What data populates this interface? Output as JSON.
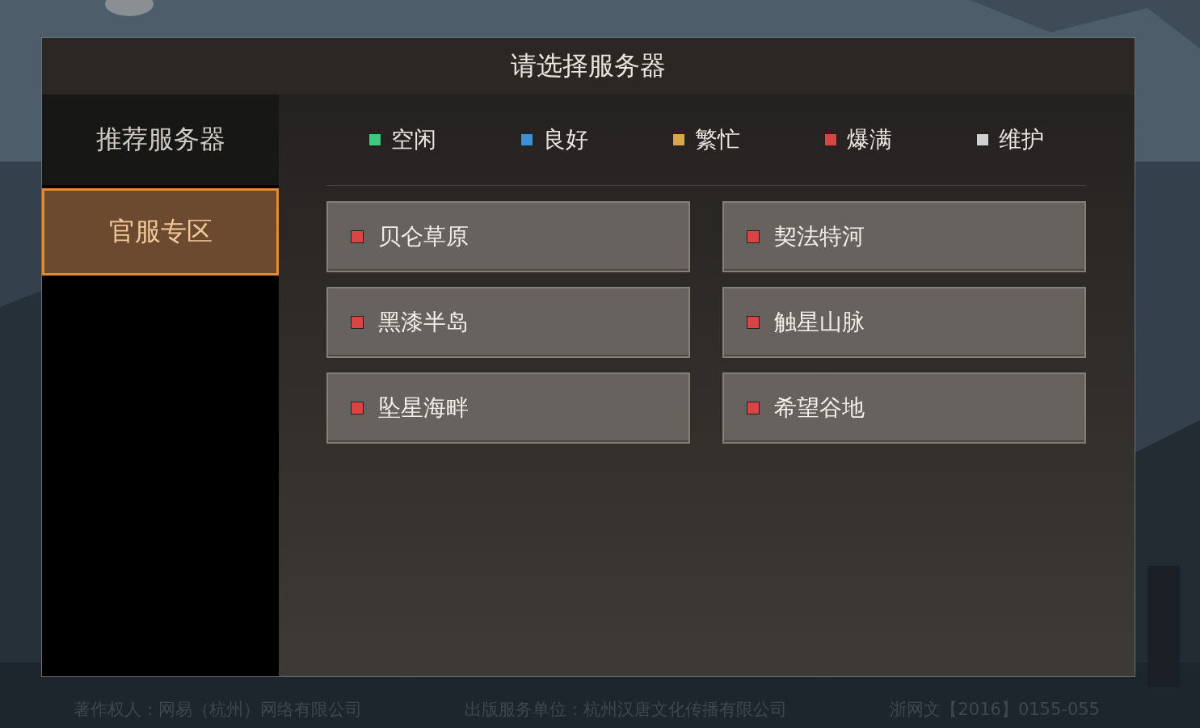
{
  "dialog": {
    "title": "请选择服务器"
  },
  "sidebar": {
    "items": [
      {
        "label": "推荐服务器",
        "selected": false
      },
      {
        "label": "官服专区",
        "selected": true
      }
    ]
  },
  "legend": [
    {
      "label": "空闲",
      "color": "#3ec97f"
    },
    {
      "label": "良好",
      "color": "#3d8fd6"
    },
    {
      "label": "繁忙",
      "color": "#d9a64a"
    },
    {
      "label": "爆满",
      "color": "#d94545"
    },
    {
      "label": "维护",
      "color": "#d0d0d0"
    }
  ],
  "servers": [
    {
      "name": "贝仑草原",
      "color": "#d94545"
    },
    {
      "name": "契法特河",
      "color": "#d94545"
    },
    {
      "name": "黑漆半岛",
      "color": "#d94545"
    },
    {
      "name": "触星山脉",
      "color": "#d94545"
    },
    {
      "name": "坠星海畔",
      "color": "#d94545"
    },
    {
      "name": "希望谷地",
      "color": "#d94545"
    }
  ],
  "footer": [
    "著作权人：网易（杭州）网络有限公司",
    "出版服务单位：杭州汉唐文化传播有限公司",
    "浙网文【2016】0155-055"
  ]
}
